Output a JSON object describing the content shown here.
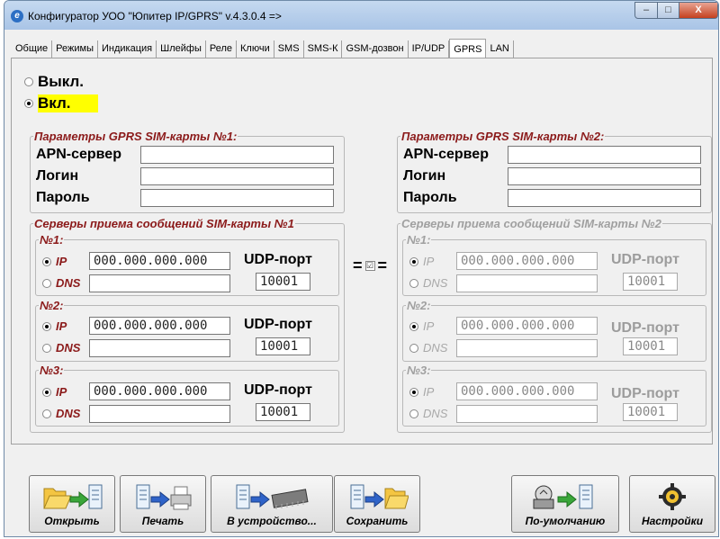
{
  "window": {
    "title": "Конфигуратор УОО \"Юпитер IP/GPRS\" v.4.3.0.4  =>",
    "min": "–",
    "max": "□",
    "close": "X"
  },
  "tabs": [
    "Общие",
    "Режимы",
    "Индикация",
    "Шлейфы",
    "Реле",
    "Ключи",
    "SMS",
    "SMS-К",
    "GSM-дозвон",
    "IP/UDP",
    "GPRS",
    "LAN"
  ],
  "mode": {
    "off": "Выкл.",
    "on": "Вкл."
  },
  "sim1": {
    "params_title": "Параметры GPRS SIM-карты №1:",
    "apn_label": "APN-сервер",
    "login_label": "Логин",
    "password_label": "Пароль",
    "servers_title": "Серверы приема сообщений SIM-карты №1",
    "servers": [
      {
        "title": "№1:",
        "ip_label": "IP",
        "ip": "000.000.000.000",
        "dns_label": "DNS",
        "dns": "",
        "udp_label": "UDP-порт",
        "port": "10001"
      },
      {
        "title": "№2:",
        "ip_label": "IP",
        "ip": "000.000.000.000",
        "dns_label": "DNS",
        "dns": "",
        "udp_label": "UDP-порт",
        "port": "10001"
      },
      {
        "title": "№3:",
        "ip_label": "IP",
        "ip": "000.000.000.000",
        "dns_label": "DNS",
        "dns": "",
        "udp_label": "UDP-порт",
        "port": "10001"
      }
    ]
  },
  "sim2": {
    "params_title": "Параметры GPRS SIM-карты №2:",
    "apn_label": "APN-сервер",
    "login_label": "Логин",
    "password_label": "Пароль",
    "servers_title": "Серверы приема сообщений SIM-карты №2",
    "servers": [
      {
        "title": "№1:",
        "ip_label": "IP",
        "ip": "000.000.000.000",
        "dns_label": "DNS",
        "dns": "",
        "udp_label": "UDP-порт",
        "port": "10001"
      },
      {
        "title": "№2:",
        "ip_label": "IP",
        "ip": "000.000.000.000",
        "dns_label": "DNS",
        "dns": "",
        "udp_label": "UDP-порт",
        "port": "10001"
      },
      {
        "title": "№3:",
        "ip_label": "IP",
        "ip": "000.000.000.000",
        "dns_label": "DNS",
        "dns": "",
        "udp_label": "UDP-порт",
        "port": "10001"
      }
    ]
  },
  "sync": {
    "left": "=",
    "check": "☑",
    "right": "="
  },
  "buttons": {
    "open": "Открыть",
    "print": "Печать",
    "to_device": "В устройство...",
    "save": "Сохранить",
    "defaults": "По-умолчанию",
    "settings": "Настройки"
  },
  "colors": {
    "legend": "#8b1a1a",
    "highlight": "#ffff00",
    "disabled": "#a0a0a0"
  }
}
